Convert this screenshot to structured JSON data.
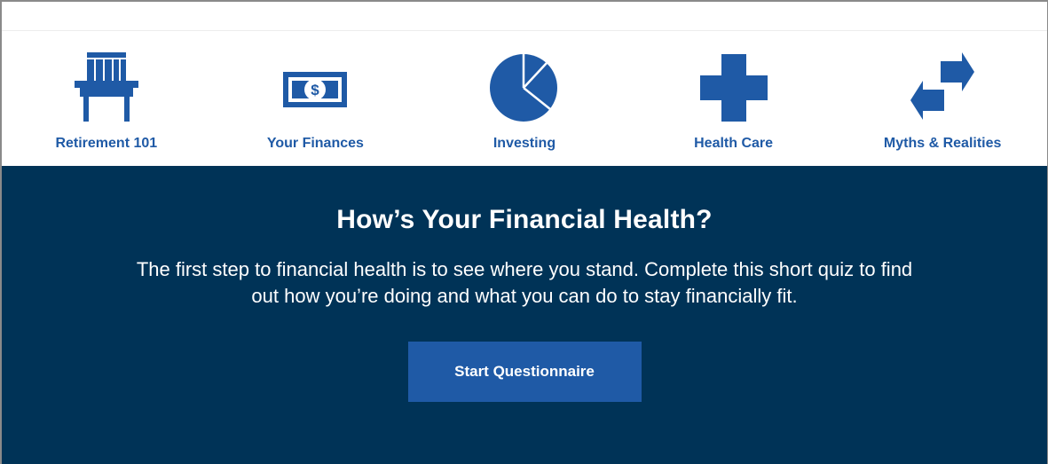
{
  "nav": {
    "items": [
      {
        "label": "Retirement 101",
        "icon": "adirondack-chair-icon"
      },
      {
        "label": "Your Finances",
        "icon": "dollar-bill-icon"
      },
      {
        "label": "Investing",
        "icon": "pie-chart-icon"
      },
      {
        "label": "Health Care",
        "icon": "medical-cross-icon"
      },
      {
        "label": "Myths & Realities",
        "icon": "swap-arrows-icon"
      }
    ]
  },
  "hero": {
    "title": "How’s Your Financial Health?",
    "text": "The first step to financial health is to see where you stand. Complete this short quiz to find out how you’re doing and what you can do to stay financially fit.",
    "button_label": "Start Questionnaire"
  },
  "colors": {
    "brand_blue": "#1f5aa6",
    "navy": "#003357",
    "white": "#ffffff"
  }
}
